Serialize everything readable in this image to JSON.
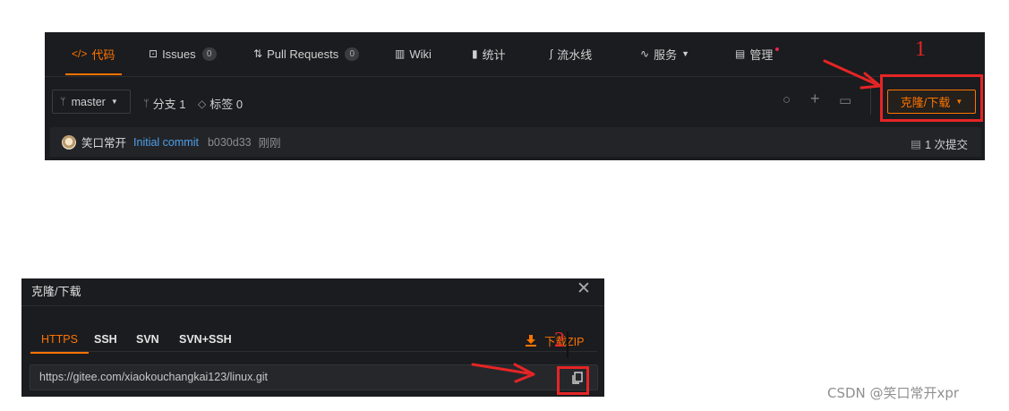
{
  "repo": {
    "tabs": [
      {
        "label": "代码",
        "icon": "code-icon"
      },
      {
        "label": "Issues",
        "icon": "issues-icon",
        "count": "0"
      },
      {
        "label": "Pull Requests",
        "icon": "pull-request-icon",
        "count": "0"
      },
      {
        "label": "Wiki",
        "icon": "book-icon"
      },
      {
        "label": "统计",
        "icon": "bar-chart-icon"
      },
      {
        "label": "流水线",
        "icon": "pipeline-icon"
      },
      {
        "label": "服务",
        "icon": "pulse-icon"
      },
      {
        "label": "管理",
        "icon": "manage-icon"
      }
    ],
    "branch": "master",
    "branches_label": "分支 1",
    "tags_label": "标签 0",
    "clone_button": "克隆/下载",
    "commit": {
      "author": "笑口常开",
      "message": "Initial commit",
      "hash": "b030d33",
      "time": "刚刚",
      "count_label": "1 次提交"
    }
  },
  "dialog": {
    "title": "克隆/下载",
    "protocols": [
      "HTTPS",
      "SSH",
      "SVN",
      "SVN+SSH"
    ],
    "download_zip": "下载ZIP",
    "url": "https://gitee.com/xiaokouchangkai123/linux.git"
  },
  "annotations": {
    "step1": "1",
    "step2": "2",
    "color": "#e52525"
  },
  "colors": {
    "accent": "#fe7300",
    "panel_bg": "#1b1c1f",
    "link": "#4ea0e8"
  },
  "watermark": "CSDN @笑口常开xpr"
}
